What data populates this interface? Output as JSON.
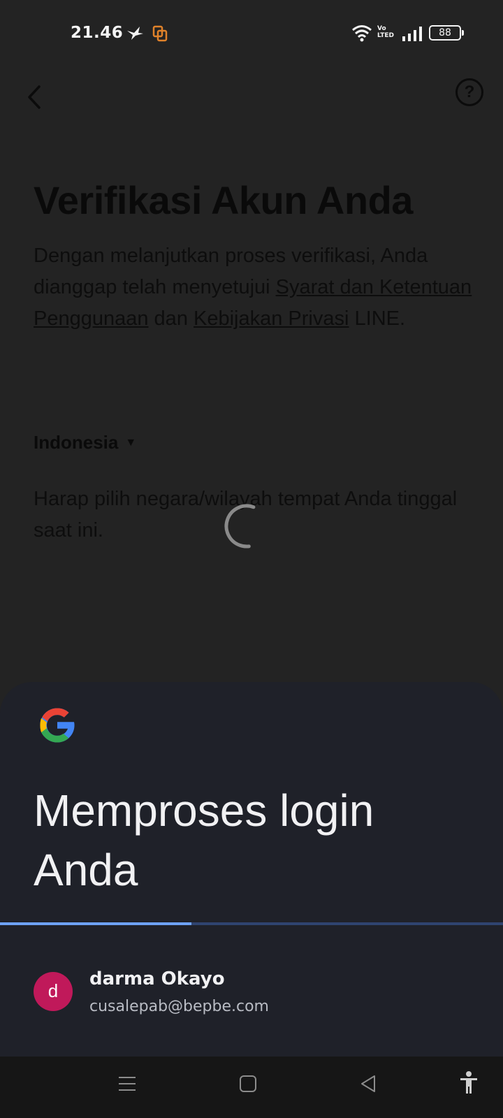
{
  "status_bar": {
    "time": "21.46",
    "volte_line1": "Vo",
    "volte_line2": "LTED",
    "battery": "88"
  },
  "header": {
    "back_icon": "chevron-left-icon",
    "help_icon": "question-circle-icon",
    "help_label": "?"
  },
  "verification": {
    "title": "Verifikasi Akun Anda",
    "desc_part1": "Dengan melanjutkan proses verifikasi, Anda dianggap telah menyetujui ",
    "link_terms": "Syarat dan Ketentuan Penggunaan",
    "desc_part2": " dan ",
    "link_privacy": "Kebijakan Privasi",
    "desc_part3": " LINE.",
    "country": "Indonesia",
    "country_caret": "▼",
    "hint": "Harap pilih negara/wilayah tempat Anda tinggal saat ini."
  },
  "sheet": {
    "title": "Memproses login Anda",
    "progress_fraction": 0.38,
    "account": {
      "avatar_letter": "d",
      "name": "darma Okayo",
      "email": "cusalepab@bepbe.com"
    }
  },
  "colors": {
    "sheet_bg": "#1f2129",
    "progress_fill": "#6ea2f6",
    "progress_track": "#2f4470",
    "avatar_bg": "#c0195a"
  }
}
